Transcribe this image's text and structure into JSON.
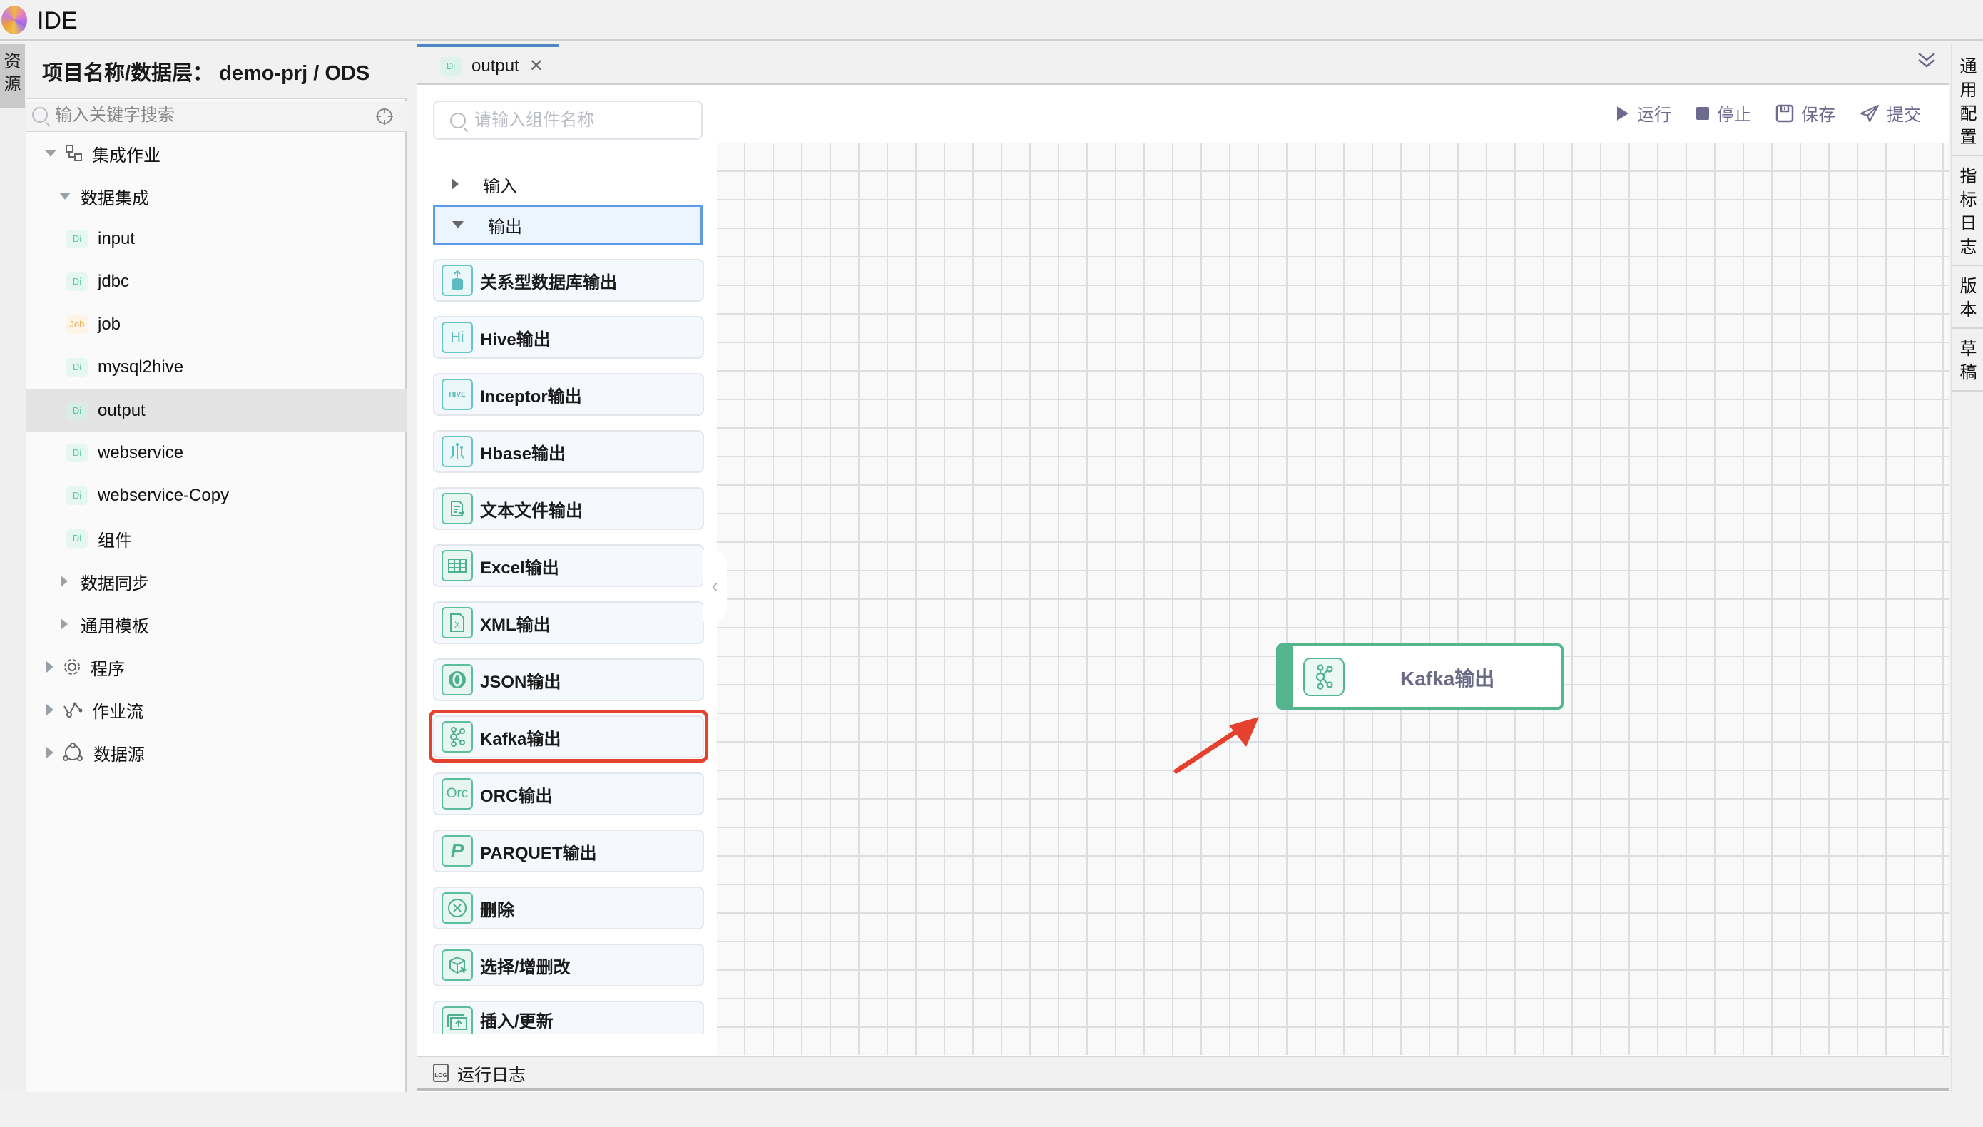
{
  "app": {
    "title": "IDE"
  },
  "left_strip": {
    "tab_label": "资源"
  },
  "left_panel": {
    "header": "项目名称/数据层：  demo-prj / ODS",
    "search_placeholder": "输入关键字搜索",
    "tree": [
      {
        "label": "集成作业",
        "level": 0,
        "state": "expanded",
        "icon": "integration-icon"
      },
      {
        "label": "数据集成",
        "level": 1,
        "state": "expanded"
      },
      {
        "label": "input",
        "level": 2,
        "badge": "Di"
      },
      {
        "label": "jdbc",
        "level": 2,
        "badge": "Di"
      },
      {
        "label": "job",
        "level": 2,
        "badge": "Job"
      },
      {
        "label": "mysql2hive",
        "level": 2,
        "badge": "Di"
      },
      {
        "label": "output",
        "level": 2,
        "badge": "Di",
        "selected": true
      },
      {
        "label": "webservice",
        "level": 2,
        "badge": "Di"
      },
      {
        "label": "webservice-Copy",
        "level": 2,
        "badge": "Di"
      },
      {
        "label": "组件",
        "level": 2,
        "badge": "Di"
      },
      {
        "label": "数据同步",
        "level": 1,
        "state": "collapsed"
      },
      {
        "label": "通用模板",
        "level": 1,
        "state": "collapsed"
      },
      {
        "label": "程序",
        "level": 0,
        "state": "collapsed",
        "icon": "gear-icon"
      },
      {
        "label": "作业流",
        "level": 0,
        "state": "collapsed",
        "icon": "workflow-icon"
      },
      {
        "label": "数据源",
        "level": 0,
        "state": "collapsed",
        "icon": "datasource-icon"
      }
    ]
  },
  "tabs": [
    {
      "label": "output",
      "badge": "Di",
      "active": true
    }
  ],
  "component_panel": {
    "search_placeholder": "请输入组件名称",
    "groups": [
      {
        "label": "输入",
        "expanded": false
      },
      {
        "label": "输出",
        "expanded": true
      }
    ],
    "components": [
      {
        "label": "关系型数据库输出",
        "icon": "database-upload-icon",
        "icon_text": "⛁"
      },
      {
        "label": "Hive输出",
        "icon": "hive-icon",
        "icon_text": "Hi"
      },
      {
        "label": "Inceptor输出",
        "icon": "inceptor-hive-icon",
        "icon_text": "HIVE"
      },
      {
        "label": "Hbase输出",
        "icon": "hbase-icon",
        "icon_text": "⫛"
      },
      {
        "label": "文本文件输出",
        "icon": "text-file-icon",
        "icon_text": "▤"
      },
      {
        "label": "Excel输出",
        "icon": "excel-table-icon",
        "icon_text": "▦"
      },
      {
        "label": "XML输出",
        "icon": "xml-file-icon",
        "icon_text": "X"
      },
      {
        "label": "JSON输出",
        "icon": "json-icon",
        "icon_text": "◉"
      },
      {
        "label": "Kafka输出",
        "icon": "kafka-icon",
        "icon_text": "",
        "highlighted": true
      },
      {
        "label": "ORC输出",
        "icon": "orc-icon",
        "icon_text": "Orc"
      },
      {
        "label": "PARQUET输出",
        "icon": "parquet-icon",
        "icon_text": "P"
      },
      {
        "label": "删除",
        "icon": "delete-circle-icon",
        "icon_text": "⊗"
      },
      {
        "label": "选择/增删改",
        "icon": "cube-select-icon",
        "icon_text": "⬡"
      },
      {
        "label": "插入/更新",
        "icon": "insert-update-icon",
        "icon_text": "⇪"
      }
    ]
  },
  "toolbar": {
    "run": "运行",
    "stop": "停止",
    "save": "保存",
    "submit": "提交"
  },
  "canvas": {
    "nodes": [
      {
        "label": "Kafka输出",
        "icon": "kafka-icon"
      }
    ]
  },
  "bottom_bar": {
    "log_label": "运行日志",
    "log_icon_text": "LOG"
  },
  "right_strip": {
    "tabs": [
      "通用配置",
      "指标日志",
      "版本",
      "草稿"
    ]
  },
  "colors": {
    "accent_green": "#55b58f",
    "highlight_red": "#e5412f",
    "toolbar_purple": "#6e6a8f",
    "tab_blue": "#4f86c6"
  }
}
